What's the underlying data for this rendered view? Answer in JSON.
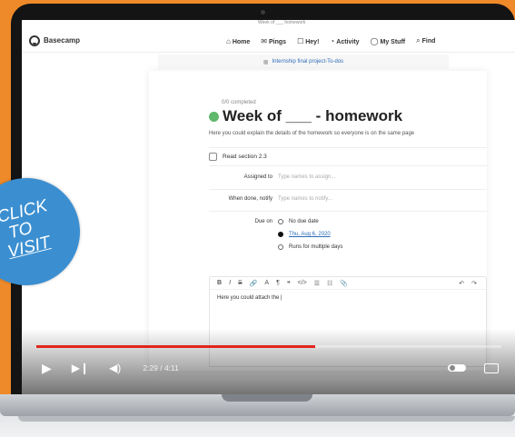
{
  "window": {
    "mini_title": "Week of ___ homework"
  },
  "app": {
    "name": "Basecamp"
  },
  "nav": [
    {
      "icon": "⌂",
      "label": "Home"
    },
    {
      "icon": "✉",
      "label": "Pings"
    },
    {
      "icon": "☐",
      "label": "Hey!"
    },
    {
      "icon": "◔",
      "label": "Activity"
    },
    {
      "icon": "◯",
      "label": "My Stuff"
    },
    {
      "icon": "⌕",
      "label": "Find"
    }
  ],
  "breadcrumb": {
    "project": "Internship final project",
    "sep": " › ",
    "list": "To-dos"
  },
  "todo_list": {
    "completed": "0/0 completed",
    "title": "Week of ___ - homework",
    "description": "Here you could explain the details of the homework so everyone is on the same page"
  },
  "todo_item": {
    "label": "Read section 2.3"
  },
  "form": {
    "assigned_label": "Assigned to",
    "assigned_placeholder": "Type names to assign...",
    "notify_label": "When done, notify",
    "notify_placeholder": "Type names to notify...",
    "due_label": "Due on",
    "due_options": [
      "No due date",
      "Thu, Aug 6, 2020",
      "Runs for multiple days"
    ],
    "due_selected": 1
  },
  "editor": {
    "toolbar": [
      "B",
      "I",
      "S",
      "🔗",
      "A",
      "¶",
      "❝",
      "</>",
      "☰",
      "☷",
      "📎"
    ],
    "toolbar_right": [
      "↶",
      "↷"
    ],
    "text": "Here you could attach the |"
  },
  "video": {
    "current_time": "2:29",
    "duration": "4:11",
    "progress": 0.6
  },
  "badge": {
    "lines": [
      "CLICK",
      "TO",
      "VISIT"
    ]
  },
  "colors": {
    "accent_orange": "#ee8a2a",
    "badge_blue": "#3b8fd1",
    "progress_red": "#e1261c",
    "done_green": "#5fb86b"
  }
}
